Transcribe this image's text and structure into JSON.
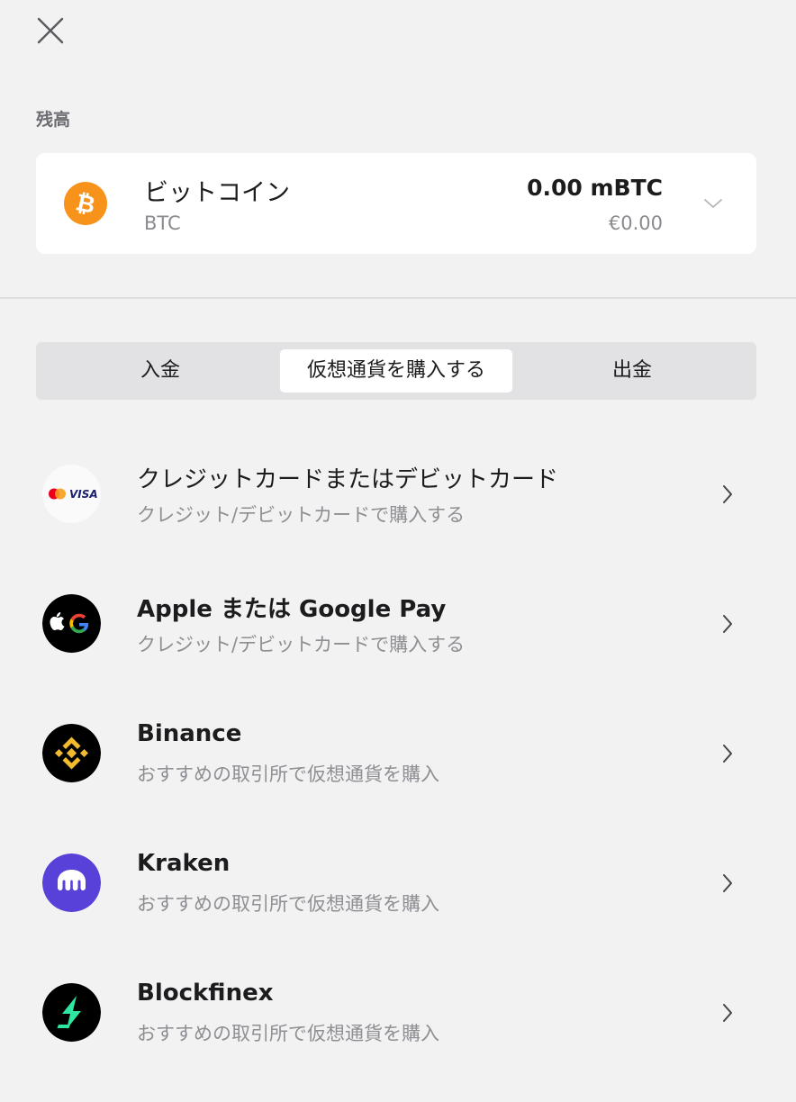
{
  "header": {
    "close_icon": "close-icon"
  },
  "balance": {
    "section_label": "残高",
    "coin_name": "ビットコイン",
    "coin_symbol": "BTC",
    "amount": "0.00 mBTC",
    "fiat_value": "€0.00",
    "coin_icon": "bitcoin-icon",
    "accent_color": "#f7931a"
  },
  "tabs": [
    {
      "label": "入金",
      "selected": false
    },
    {
      "label": "仮想通貨を購入する",
      "selected": true
    },
    {
      "label": "出金",
      "selected": false
    }
  ],
  "methods": [
    {
      "title": "クレジットカードまたはデビットカード",
      "subtitle": "クレジット/デビットカードで購入する",
      "icon": "mastercard-visa-icon"
    },
    {
      "title": "Apple または Google Pay",
      "subtitle": "クレジット/デビットカードで購入する",
      "icon": "apple-google-pay-icon"
    },
    {
      "title": "Binance",
      "subtitle": "おすすめの取引所で仮想通貨を購入",
      "icon": "binance-icon"
    },
    {
      "title": "Kraken",
      "subtitle": "おすすめの取引所で仮想通貨を購入",
      "icon": "kraken-icon"
    },
    {
      "title": "Blockfinex",
      "subtitle": "おすすめの取引所で仮想通貨を購入",
      "icon": "blockfinex-icon"
    }
  ],
  "colors": {
    "background": "#f2f2f3",
    "card": "#ffffff",
    "binance": "#f3ba2f",
    "kraken": "#5741d9",
    "blockfinex": "#2ee6a0"
  }
}
